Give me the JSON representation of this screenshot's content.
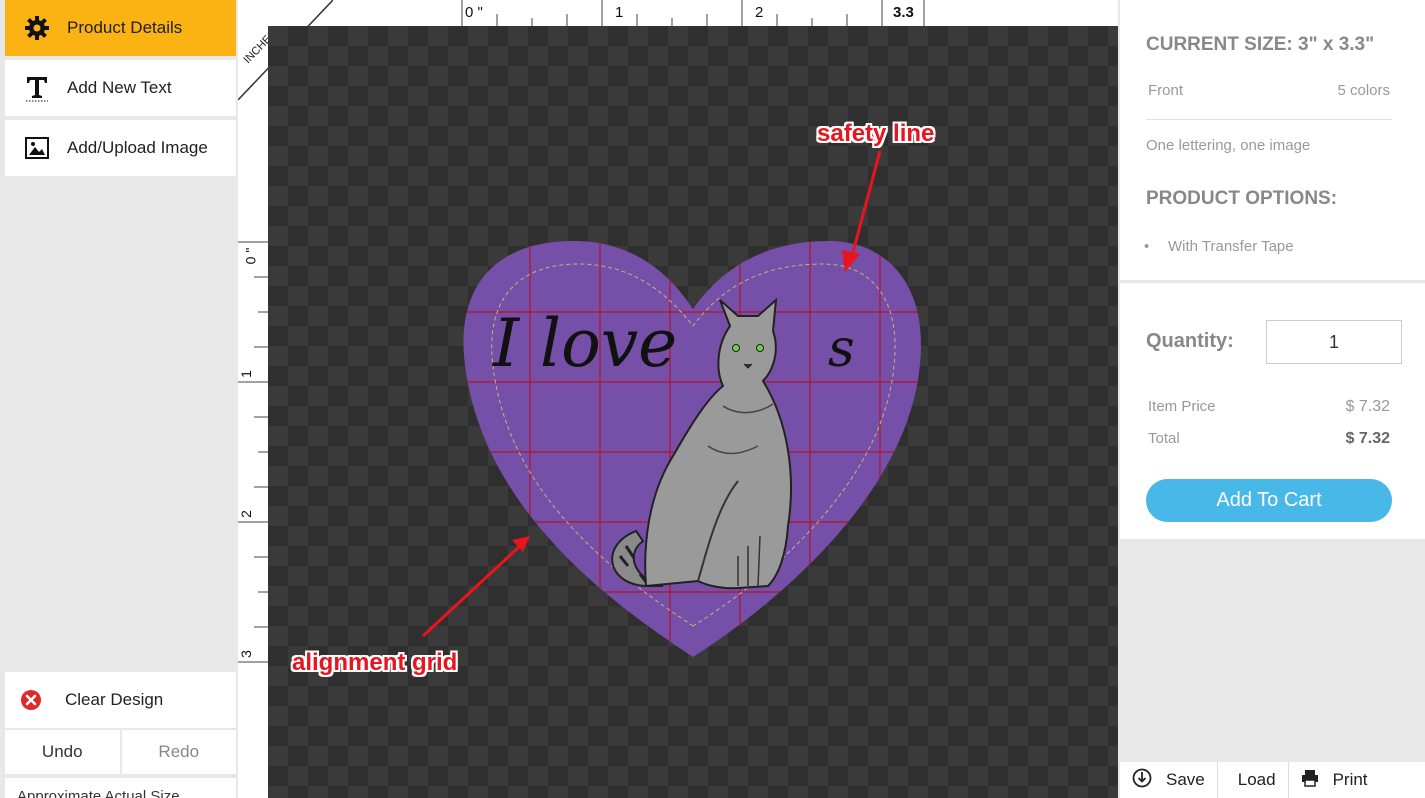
{
  "tools": {
    "product_details": "Product Details",
    "add_text": "Add New Text",
    "add_image": "Add/Upload Image",
    "clear_design": "Clear Design",
    "undo": "Undo",
    "redo": "Redo",
    "approx": "Approximate Actual Size"
  },
  "ruler": {
    "corner_label": "INCHES",
    "top_labels": [
      "0 \"",
      "1",
      "2",
      "3.3"
    ],
    "left_labels": [
      "0 \"",
      "1",
      "2",
      "3"
    ]
  },
  "design": {
    "text": "I love",
    "text2": "s",
    "shape_color": "#7650a8"
  },
  "annotations": {
    "safety": "safety line",
    "grid": "alignment grid"
  },
  "details": {
    "current_size": "CURRENT SIZE: 3\" x 3.3\"",
    "side": "Front",
    "colors": "5 colors",
    "note": "One lettering, one image",
    "options_title": "PRODUCT OPTIONS:",
    "option_1": "With Transfer Tape"
  },
  "order": {
    "quantity_label": "Quantity:",
    "quantity": "1",
    "item_price_label": "Item Price",
    "item_price": "$ 7.32",
    "total_label": "Total",
    "total": "$ 7.32",
    "add_to_cart": "Add To Cart"
  },
  "bottom": {
    "save": "Save",
    "load": "Load",
    "print": "Print"
  },
  "colors": {
    "accent": "#fbb213",
    "cart": "#47b8e8",
    "annotation": "#e8141e"
  }
}
